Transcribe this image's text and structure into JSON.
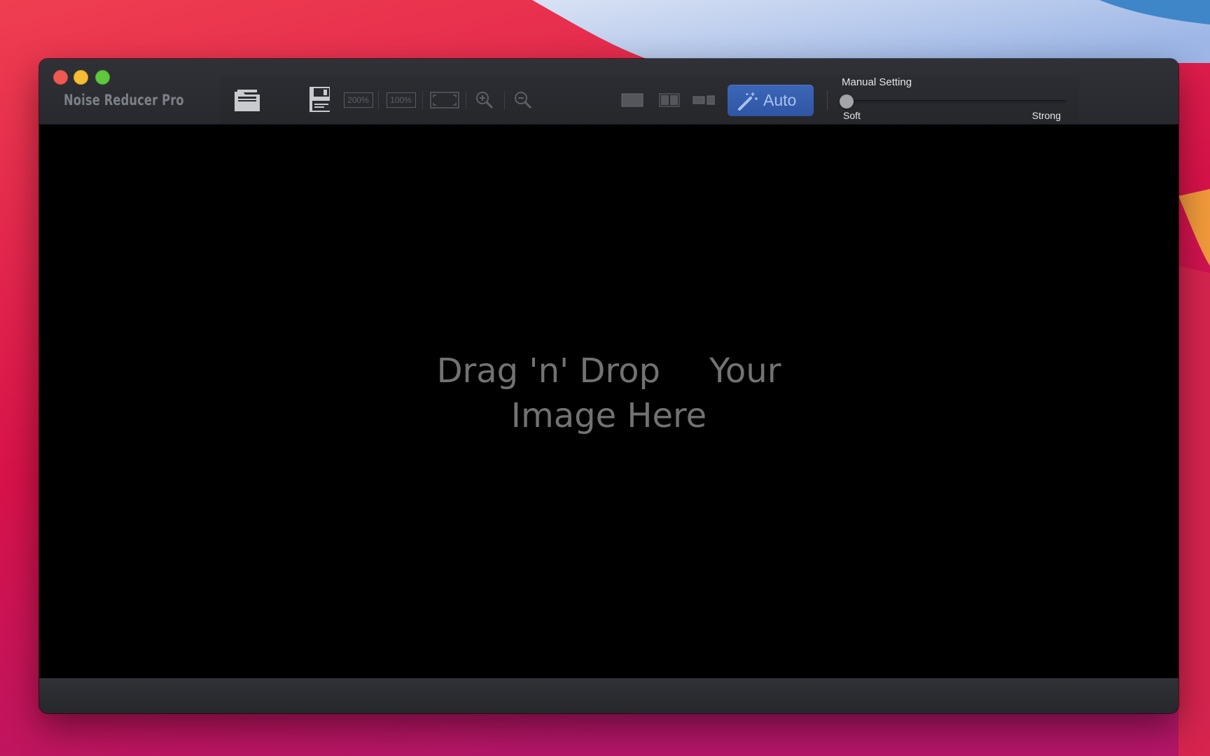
{
  "app": {
    "title": "Noise Reducer Pro"
  },
  "toolbar": {
    "zoom_200_label": "200%",
    "zoom_100_label": "100%",
    "auto_label": "Auto",
    "manual_setting_label": "Manual Setting",
    "slider_min_label": "Soft",
    "slider_max_label": "Strong",
    "slider_value": 0,
    "accent_color": "#3560b0"
  },
  "canvas": {
    "drop_line1_a": "Drag 'n' Drop",
    "drop_line1_b": "Your",
    "drop_line2": "Image Here"
  },
  "window_controls": {
    "close_color": "#ee5a52",
    "minimize_color": "#f4bd33",
    "zoom_color": "#5fc73e"
  }
}
